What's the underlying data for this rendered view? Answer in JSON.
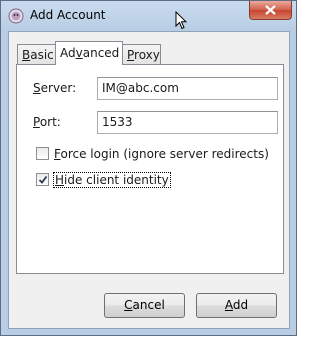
{
  "window": {
    "title": "Add Account"
  },
  "tabs": [
    {
      "key": "B",
      "rest": "asic"
    },
    {
      "pre": "Ad",
      "key": "v",
      "rest": "anced"
    },
    {
      "key": "P",
      "rest": "roxy"
    }
  ],
  "advanced": {
    "server": {
      "label_key": "S",
      "label_rest": "erver:",
      "value": "IM@abc.com"
    },
    "port": {
      "label_key": "P",
      "label_rest": "ort:",
      "value": "1533"
    },
    "force_login": {
      "key": "F",
      "rest": "orce login (ignore server redirects)",
      "checked": false
    },
    "hide_identity": {
      "key": "H",
      "rest": "ide client identity",
      "checked": true
    }
  },
  "buttons": {
    "cancel": {
      "key": "C",
      "rest": "ancel"
    },
    "add": {
      "key": "A",
      "rest": "dd"
    }
  },
  "icons": {
    "app": "application-icon",
    "close": "close-icon",
    "cursor": "mouse-cursor-icon",
    "check": "checkmark-icon"
  }
}
